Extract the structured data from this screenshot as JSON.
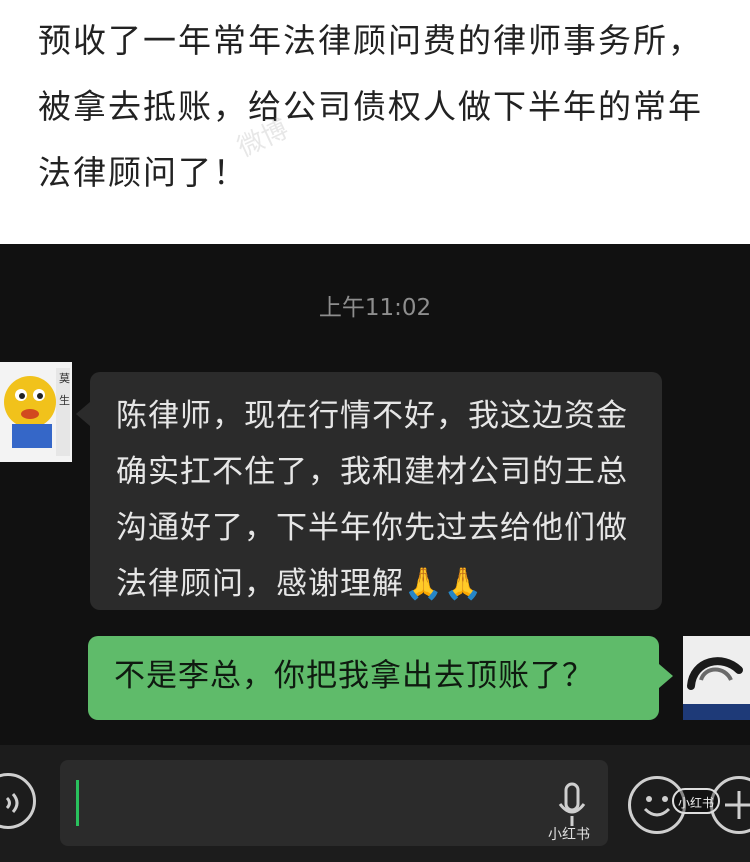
{
  "caption": {
    "text": "预收了一年常年法律顾问费的律师事务所，被拿去抵账，给公司债权人做下半年的常年法律顾问了！"
  },
  "chat": {
    "timestamp": "上午11:02",
    "incoming_message": "陈律师，现在行情不好，我这边资金确实扛不住了，我和建材公司的王总沟通好了，下半年你先过去给他们做法律顾问，感谢理解🙏🙏",
    "outgoing_message": "不是李总，你把我拿出去顶账了？"
  },
  "input_bar": {
    "value": ""
  },
  "watermarks": {
    "weibo": "微博",
    "xiaohongshu_badge": "小红书",
    "xiaohongshu_text": "小红书"
  },
  "icons": {
    "voice": "voice-icon",
    "mic": "microphone-icon",
    "emoji": "emoji-icon",
    "plus": "plus-icon"
  },
  "colors": {
    "chat_bg": "#111111",
    "incoming_bubble": "#2b2b2b",
    "outgoing_bubble": "#5fbb6a",
    "cursor": "#29c15d"
  }
}
